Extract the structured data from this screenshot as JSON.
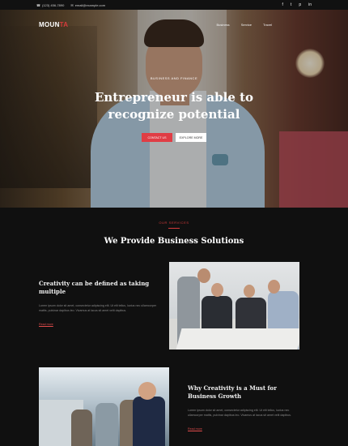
{
  "topbar": {
    "phone": "(123) 456-7890",
    "email": "email@example.com",
    "social_icons": [
      "facebook-icon",
      "twitter-icon",
      "pinterest-icon",
      "linkedin-icon"
    ],
    "social_glyphs": [
      "f",
      "t",
      "p",
      "in"
    ]
  },
  "nav": {
    "logo_main": "MOUN",
    "logo_accent": "TA",
    "items": [
      "Business",
      "Service",
      "Travel"
    ]
  },
  "hero": {
    "eyebrow": "BUSINESS AND FINANCE",
    "headline_line1": "Entrepreneur is able to",
    "headline_line2": "recognize potential",
    "primary_button": "CONTACT US",
    "secondary_button": "EXPLORE MORE"
  },
  "section": {
    "kicker": "OUR SERVICES",
    "title": "We Provide Business Solutions"
  },
  "blocks": [
    {
      "title": "Creativity can be defined as taking multiple",
      "text": "Lorem ipsum dolor sit amet, consectetur adipiscing elit. Ut elit tellus, luctus nec ullamcorper mattis, pulvinar dapibus leo. Vivamus at lacus sit amet velit dapibus.",
      "link": "Read more"
    },
    {
      "title": "Why Creativity is a Must for Business Growth",
      "text": "Lorem ipsum dolor sit amet, consectetur adipiscing elit. Ut elit tellus, luctus nec ullamcorper mattis, pulvinar dapibus leo. Vivamus at lacus sit amet velit dapibus.",
      "link": "Read more"
    }
  ],
  "colors": {
    "accent": "#e03d45",
    "background": "#101010"
  }
}
